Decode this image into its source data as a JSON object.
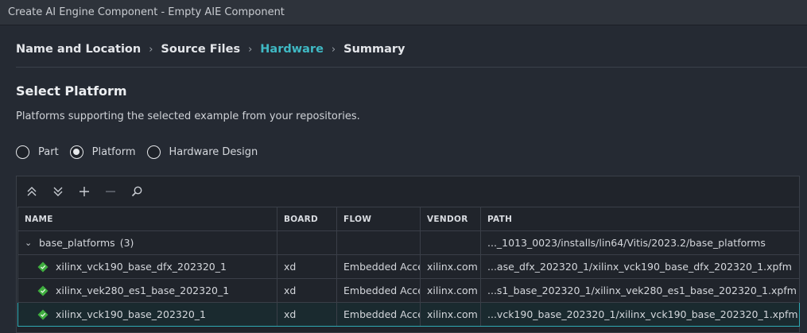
{
  "window": {
    "title": "Create AI Engine Component - Empty AIE Component"
  },
  "breadcrumb": {
    "steps": [
      {
        "label": "Name and Location"
      },
      {
        "label": "Source Files"
      },
      {
        "label": "Hardware"
      },
      {
        "label": "Summary"
      }
    ],
    "active_index": 2,
    "separator": ">"
  },
  "section": {
    "title": "Select Platform",
    "description": "Platforms supporting the selected example from your repositories."
  },
  "radios": {
    "options": [
      {
        "label": "Part",
        "checked": false
      },
      {
        "label": "Platform",
        "checked": true
      },
      {
        "label": "Hardware Design",
        "checked": false
      }
    ]
  },
  "toolbar": {
    "icons": [
      "collapse-all-icon",
      "expand-all-icon",
      "add-icon",
      "remove-icon",
      "search-icon"
    ]
  },
  "table": {
    "columns": [
      "NAME",
      "BOARD",
      "FLOW",
      "VENDOR",
      "PATH"
    ],
    "group": {
      "name": "base_platforms",
      "count": "(3)",
      "path": "..._1013_0023/installs/lin64/Vitis/2023.2/base_platforms"
    },
    "rows": [
      {
        "name": "xilinx_vck190_base_dfx_202320_1",
        "board": "xd",
        "flow": "Embedded Accel",
        "vendor": "xilinx.com",
        "path": "...ase_dfx_202320_1/xilinx_vck190_base_dfx_202320_1.xpfm"
      },
      {
        "name": "xilinx_vek280_es1_base_202320_1",
        "board": "xd",
        "flow": "Embedded Accel",
        "vendor": "xilinx.com",
        "path": "...s1_base_202320_1/xilinx_vek280_es1_base_202320_1.xpfm"
      },
      {
        "name": "xilinx_vck190_base_202320_1",
        "board": "xd",
        "flow": "Embedded Accel",
        "vendor": "xilinx.com",
        "path": "...vck190_base_202320_1/xilinx_vck190_base_202320_1.xpfm"
      }
    ],
    "selected_row": 2
  },
  "colors": {
    "accent": "#3fb9c4",
    "platform_icon": "#3fae3f",
    "background": "#252a33"
  }
}
